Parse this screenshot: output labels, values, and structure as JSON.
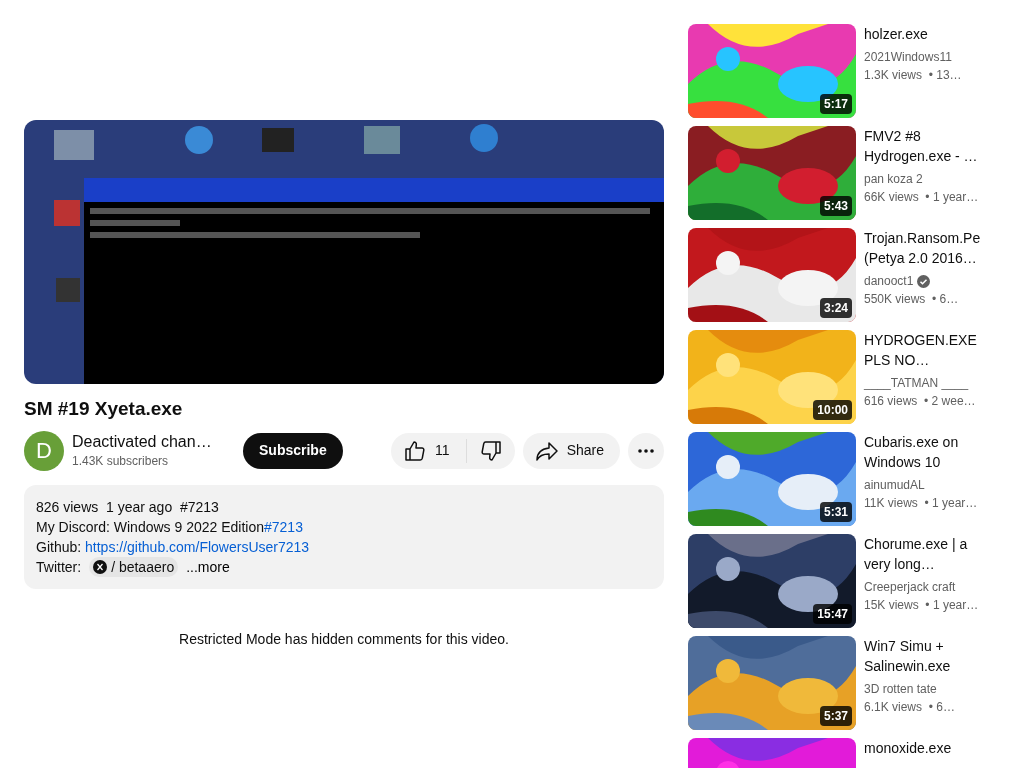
{
  "video": {
    "kind": "picture",
    "title": "SM #19 Xyeta.exe"
  },
  "channel": {
    "avatar_letter": "D",
    "name": "Deactivated chan…",
    "subscribers": "1.43K subscribers",
    "subscribe_label": "Subscribe"
  },
  "actions": {
    "likes": "11",
    "share": "Share"
  },
  "description": {
    "stats": "826 views  1 year ago  #7213",
    "lines": [
      {
        "label": "My Discord: Windows 9 2022 Edition",
        "link": "#7213"
      },
      {
        "label": "Github: ",
        "link": "https://github.com/FlowersUser7213"
      }
    ],
    "twitter_label": "Twitter:",
    "twitter_handle": "/ betaaero",
    "more": "...more"
  },
  "comments_notice": "Restricted Mode has hidden comments for this video.",
  "related": [
    {
      "title": "holzer.exe",
      "channel": "2021Windows11",
      "verified": false,
      "meta": "1.3K views  • 13…",
      "duration": "5:17"
    },
    {
      "title": "FMV2 #8 Hydrogen.exe - …",
      "channel": "pan koza 2",
      "verified": false,
      "meta": "66K views  • 1 year…",
      "duration": "5:43"
    },
    {
      "title": "Trojan.Ransom.Pe (Petya 2.0 2016…",
      "channel": "danooct1",
      "verified": true,
      "meta": "550K views  • 6…",
      "duration": "3:24"
    },
    {
      "title": "HYDROGEN.EXE PLS NO…",
      "channel": "____TATMAN ____",
      "verified": false,
      "meta": "616 views  • 2 wee…",
      "duration": "10:00"
    },
    {
      "title": "Cubaris.exe on Windows 10",
      "channel": "ainumudAL",
      "verified": false,
      "meta": "11K views  • 1 year…",
      "duration": "5:31"
    },
    {
      "title": "Chorume.exe | a very long…",
      "channel": "Creeperjack craft",
      "verified": false,
      "meta": "15K views  • 1 year…",
      "duration": "15:47"
    },
    {
      "title": "Win7 Simu + Salinewin.exe",
      "channel": "3D rotten tate",
      "verified": false,
      "meta": "6.1K views  • 6…",
      "duration": "5:37"
    },
    {
      "title": "monoxide.exe"
    }
  ]
}
